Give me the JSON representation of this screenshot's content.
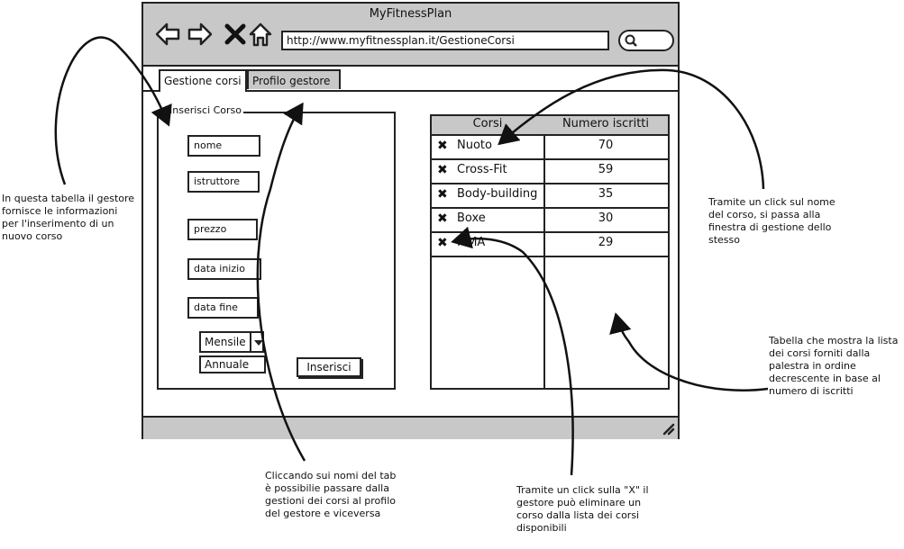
{
  "window": {
    "title": "MyFitnessPlan",
    "url": "http://www.myfitnessplan.it/GestioneCorsi"
  },
  "nav_icons": [
    "back-arrow-icon",
    "forward-arrow-icon",
    "close-x-icon",
    "home-icon",
    "search-icon",
    "resize-grip-icon"
  ],
  "tabs": [
    {
      "label": "Gestione corsi",
      "active": true
    },
    {
      "label": "Profilo gestore",
      "active": false
    }
  ],
  "insert_form": {
    "legend": "Inserisci Corso",
    "fields": {
      "nome": "nome",
      "istruttore": "istruttore",
      "prezzo": "prezzo",
      "data_inizio": "data inizio",
      "data_fine": "data fine"
    },
    "select": {
      "selected": "Mensile",
      "options": [
        "Annuale"
      ]
    },
    "submit_label": "Inserisci"
  },
  "courses_table": {
    "headers": [
      "Corsi",
      "Numero iscritti"
    ],
    "delete_glyph": "✖",
    "rows": [
      {
        "name": "Nuoto",
        "count": "70"
      },
      {
        "name": "Cross-Fit",
        "count": "59"
      },
      {
        "name": "Body-building",
        "count": "35"
      },
      {
        "name": "Boxe",
        "count": "30"
      },
      {
        "name": "MMA",
        "count": "29"
      }
    ]
  },
  "annotations": {
    "left": "In questa tabella il gestore fornisce le informazioni per l'inserimento di un nuovo corso",
    "bottom_tabs": "Cliccando sui nomi del tab è possibilie passare dalla gestioni dei corsi al profilo del gestore e viceversa",
    "bottom_x": "Tramite un click sulla \"X\" il gestore può eliminare un corso dalla lista dei corsi disponibili",
    "right_top": "Tramite un click sul nome del corso, si passa alla finestra di gestione dello stesso",
    "right_bottom": "Tabella che mostra la lista dei corsi forniti dalla palestra in ordine decrescente in base al numero di iscritti"
  }
}
